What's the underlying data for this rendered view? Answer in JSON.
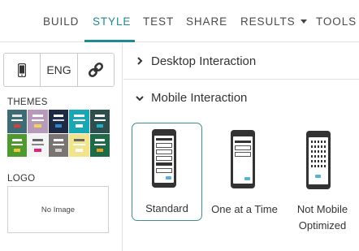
{
  "nav": {
    "tabs": [
      {
        "label": "BUILD"
      },
      {
        "label": "STYLE"
      },
      {
        "label": "TEST"
      },
      {
        "label": "SHARE"
      },
      {
        "label": "RESULTS"
      },
      {
        "label": "TOOLS"
      }
    ],
    "active_tab": "STYLE"
  },
  "left": {
    "language": "ENG",
    "themes_label": "THEMES",
    "logo_label": "LOGO",
    "logo_placeholder": "No Image",
    "themes": [
      {
        "bg": "#3d6b76",
        "a": "#e9e9e9",
        "b": "#ffffff",
        "c": "#e03b3b"
      },
      {
        "bg": "#b79ab9",
        "a": "#ffffff",
        "b": "#ffffff",
        "c": "#f0d35a"
      },
      {
        "bg": "#1e2a44",
        "a": "#ffffff",
        "b": "#cfd7e6",
        "c": "#2f87c8"
      },
      {
        "bg": "#18a7b3",
        "a": "#ffffff",
        "b": "#ffffff",
        "c": "#ffffff"
      },
      {
        "bg": "#2f4f4f",
        "a": "#ffffff",
        "b": "#ffffff",
        "c": "#1bb3c6"
      },
      {
        "bg": "#4f9a2f",
        "a": "#ffffff",
        "b": "#ffffff",
        "c": "#eec93a"
      },
      {
        "bg": "#f4f4f4",
        "a": "#666666",
        "b": "#888888",
        "c": "#e2217d"
      },
      {
        "bg": "#7a7472",
        "a": "#ffffff",
        "b": "#ffffff",
        "c": "#d9cfcb"
      },
      {
        "bg": "#f2e48a",
        "a": "#666666",
        "b": "#ffffff",
        "c": "#ffffff"
      },
      {
        "bg": "#1e6b4a",
        "a": "#ffffff",
        "b": "#ffffff",
        "c": "#e9a21f"
      }
    ]
  },
  "right": {
    "desktop_label": "Desktop Interaction",
    "mobile_label": "Mobile Interaction",
    "options": [
      {
        "label": "Standard",
        "selected": true
      },
      {
        "label": "One at a Time",
        "selected": false
      },
      {
        "label": "Not Mobile Optimized",
        "selected": false
      }
    ]
  },
  "colors": {
    "accent": "#1f8a8f",
    "button": "#5ab1d6"
  }
}
